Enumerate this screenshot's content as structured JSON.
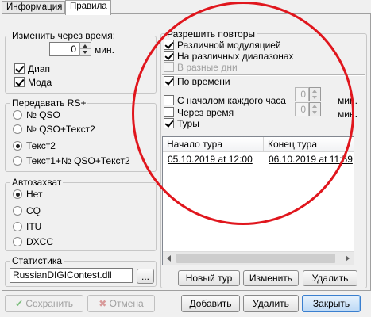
{
  "tabs": [
    "Информация",
    "Правила"
  ],
  "time_change": {
    "title": "Изменить через время:",
    "value": "0",
    "unit": "мин.",
    "checks": [
      {
        "label": "Диап",
        "checked": true
      },
      {
        "label": "Мода",
        "checked": true
      }
    ]
  },
  "rs_transmit": {
    "title": "Передавать RS+",
    "options": [
      {
        "label": "№ QSO",
        "selected": false
      },
      {
        "label": "№ QSO+Текст2",
        "selected": false
      },
      {
        "label": "Текст2",
        "selected": true
      },
      {
        "label": "Текст1+№ QSO+Текст2",
        "selected": false
      }
    ]
  },
  "autocapture": {
    "title": "Автозахват",
    "options": [
      {
        "label": "Нет",
        "selected": true
      },
      {
        "label": "CQ",
        "selected": false
      },
      {
        "label": "ITU",
        "selected": false
      },
      {
        "label": "DXCC",
        "selected": false
      }
    ]
  },
  "statistics": {
    "title": "Статистика",
    "file": "RussianDIGIContest.dll",
    "browse_label": "..."
  },
  "repeats": {
    "title": "Разрешить повторы",
    "options": [
      {
        "label": "Различной модуляцией",
        "checked": true,
        "disabled": false
      },
      {
        "label": "На различных диапазонах",
        "checked": true,
        "disabled": false
      },
      {
        "label": "В разные дни",
        "checked": false,
        "disabled": true
      }
    ],
    "by_time": {
      "label": "По времени",
      "checked": true
    },
    "each_hour": {
      "label": "С началом каждого часа",
      "checked": false,
      "value": "0",
      "unit": "мин."
    },
    "after_time": {
      "label": "Через время",
      "checked": false,
      "value": "0",
      "unit": "мин."
    },
    "tours": {
      "label": "Туры",
      "checked": true
    },
    "table": {
      "columns": [
        "Начало тура",
        "Конец тура"
      ],
      "rows": [
        {
          "start": "05.10.2019 at 12:00",
          "end": "06.10.2019 at 11:59"
        }
      ]
    },
    "buttons": {
      "new_tour": "Новый тур",
      "edit": "Изменить",
      "delete": "Удалить"
    }
  },
  "footer": {
    "save": "Сохранить",
    "cancel": "Отмена",
    "add": "Добавить",
    "remove": "Удалить",
    "close": "Закрыть"
  },
  "colors": {
    "annotation": "#e0161d",
    "accent": "#3a7fcf",
    "check_green": "#3aa63a",
    "cross_red": "#c84848"
  }
}
